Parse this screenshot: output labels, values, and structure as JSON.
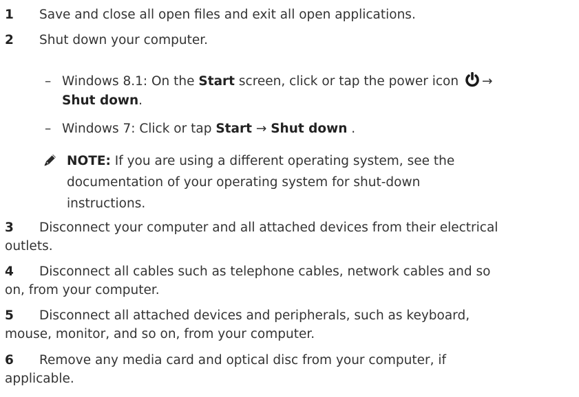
{
  "steps": [
    {
      "num": "1",
      "lines": [
        "Save and close all open files and exit all open applications."
      ]
    },
    {
      "num": "2",
      "lines": [
        "Shut down your computer."
      ]
    },
    {
      "num": "3",
      "lines": [
        "Disconnect your computer and all attached devices from their electrical",
        "outlets."
      ]
    },
    {
      "num": "4",
      "lines": [
        "Disconnect all cables such as telephone cables, network cables and so",
        "on, from your computer."
      ]
    },
    {
      "num": "5",
      "lines": [
        "Disconnect all attached devices and peripherals, such as keyboard,",
        "mouse, monitor, and so on, from your computer."
      ]
    },
    {
      "num": "6",
      "lines": [
        "Remove any media card and optical disc from your computer, if",
        "applicable."
      ]
    }
  ],
  "substeps": {
    "dash": "–",
    "win81": {
      "prefix": "Windows 8.1: On the ",
      "start": "Start",
      "middle": " screen, click or tap the power icon ",
      "arrow": "→",
      "shutdown": "Shut down",
      "end": "."
    },
    "win7": {
      "prefix": "Windows 7: Click or tap ",
      "start": "Start",
      "arrow": " → ",
      "shutdown": "Shut down",
      "end": " ."
    }
  },
  "note": {
    "label": "NOTE:",
    "lines": [
      " If you are using a different operating system, see the",
      "documentation of your operating system for shut-down",
      "instructions."
    ]
  },
  "icons": {
    "note": "pencil-note-icon",
    "power": "power-icon"
  }
}
